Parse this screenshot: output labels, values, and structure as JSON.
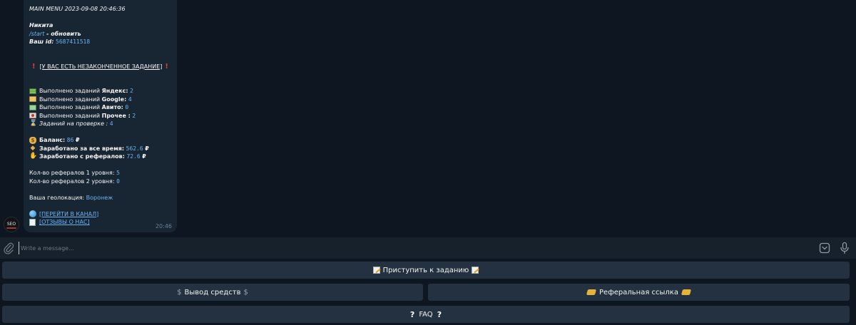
{
  "message": {
    "header": "MAIN MENU  2023-09-08 20:46:36",
    "name": "Никита",
    "start_cmd": "/start",
    "start_suffix": " - обновить",
    "id_label": "Ваш id:",
    "id_value": "5687411518",
    "warning": "[У ВАС ЕСТЬ НЕЗАКОНЧЕННОЕ ЗАДАНИЕ]",
    "tasks": [
      {
        "icon": "money-icon",
        "prefix": "Выполнено заданий ",
        "service": "Яндекс:",
        "value": "2"
      },
      {
        "icon": "money-icon",
        "prefix": "Выполнено заданий ",
        "service": "Google:",
        "value": "4"
      },
      {
        "icon": "money-icon",
        "prefix": "Выполнено заданий ",
        "service": "Авито:",
        "value": "0"
      },
      {
        "icon": "money-icon",
        "prefix": "Выполнено заданий ",
        "service": "Прочее :",
        "value": "2"
      }
    ],
    "review_label": "Заданий на проверке :",
    "review_value": "4",
    "balance_label": "Баланс:",
    "balance_value": "86",
    "earned_label": "Заработано за все время:",
    "earned_value": "562.6",
    "ref_earned_label": "Заработано с рефералов:",
    "ref_earned_value": "72.6",
    "currency": "₽",
    "ref1_label": "Кол-во рефералов 1 уровня:",
    "ref1_value": "5",
    "ref2_label": "Кол-во рефералов 2 уровня:",
    "ref2_value": "0",
    "geo_label": "Ваша геолокация:",
    "geo_value": "Воронеж",
    "link_channel": "[ПЕРЕЙТИ В КАНАЛ]",
    "link_reviews": "[ОТЗЫВЫ О НАС]",
    "time": "20:46"
  },
  "avatar": {
    "text": "SEO"
  },
  "input": {
    "placeholder": "Write a message..."
  },
  "keyboard": {
    "start_task": "Приступить к заданию",
    "withdraw": "Вывод средств",
    "referral": "Реферальная ссылка",
    "faq": "FAQ"
  },
  "colors": {
    "background": "#0e1621",
    "bubble": "#182533",
    "accent": "#6ab3f3",
    "button": "#233140",
    "warning": "#e53935"
  }
}
